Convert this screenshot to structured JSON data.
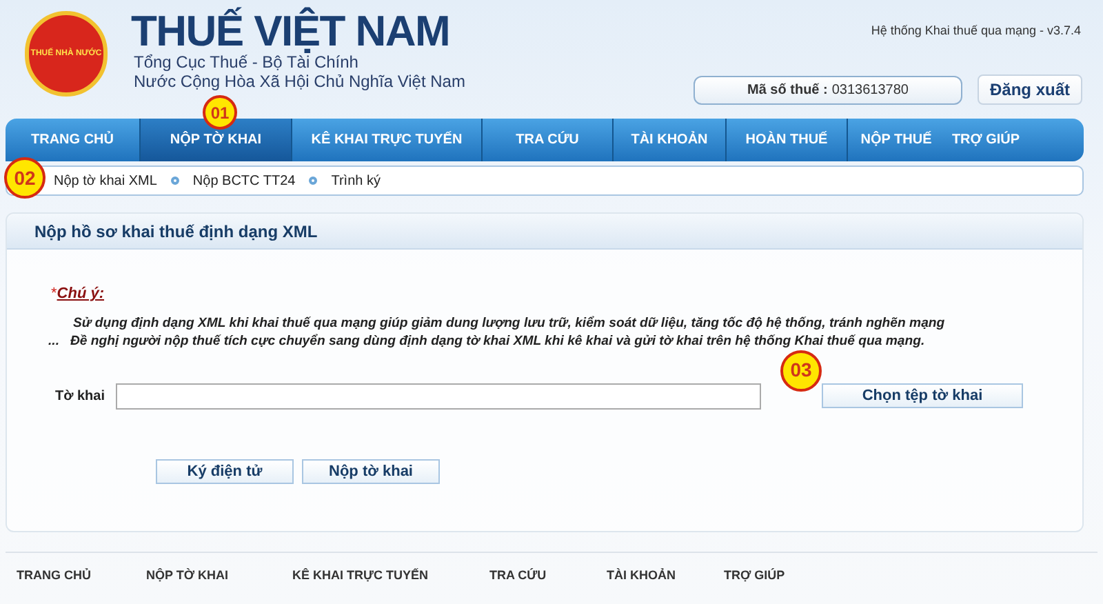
{
  "header": {
    "title": "THUẾ VIỆT NAM",
    "subtitle_lines": [
      "Tổng Cục Thuế - Bộ Tài Chính",
      "Nước Cộng Hòa Xã Hội Chủ Nghĩa Việt Nam"
    ],
    "logo_text": "THUẾ NHÀ NƯỚC",
    "version": "Hệ thống Khai thuế qua mạng - v3.7.4",
    "tax_code_label": "Mã số thuế :",
    "tax_code": "0313613780",
    "logout": "Đăng xuất"
  },
  "nav": [
    {
      "label": "TRANG CHỦ",
      "selected": false
    },
    {
      "label": "NỘP TỜ KHAI",
      "selected": true
    },
    {
      "label": "KÊ KHAI TRỰC TUYẾN",
      "selected": false
    },
    {
      "label": "TRA CỨU",
      "selected": false
    },
    {
      "label": "TÀI KHOẢN",
      "selected": false
    },
    {
      "label": "HOÀN THUẾ",
      "selected": false
    },
    {
      "label": "NỘP THUẾ",
      "selected": false
    },
    {
      "label": "TRỢ GIÚP",
      "selected": false
    }
  ],
  "subnav": [
    {
      "label": "Nộp tờ khai XML"
    },
    {
      "label": "Nộp BCTC TT24"
    },
    {
      "label": "Trình ký"
    }
  ],
  "markers": [
    "01",
    "02",
    "03"
  ],
  "panel": {
    "title": "Nộp hồ sơ khai thuế định dạng XML",
    "note_mark": "*",
    "note_label": "Chú ý:",
    "note_lines": [
      "Sử dụng định dạng XML khi khai thuế qua mạng giúp giảm dung lượng lưu trữ, kiểm soát dữ liệu, tăng tốc độ hệ thống, tránh nghẽn mạng",
      "...   Đề nghị người nộp thuế tích cực chuyển sang dùng định dạng tờ khai XML khi kê khai và gửi tờ khai trên hệ thống Khai thuế qua mạng."
    ],
    "field_label": "Tờ khai",
    "choose_button": "Chọn tệp tờ khai",
    "buttons": [
      "Ký điện tử",
      "Nộp tờ khai"
    ]
  },
  "footer": [
    "TRANG CHỦ",
    "NỘP TỜ KHAI",
    "KÊ KHAI TRỰC TUYẾN",
    "TRA CỨU",
    "TÀI KHOẢN",
    "TRỢ GIÚP"
  ]
}
